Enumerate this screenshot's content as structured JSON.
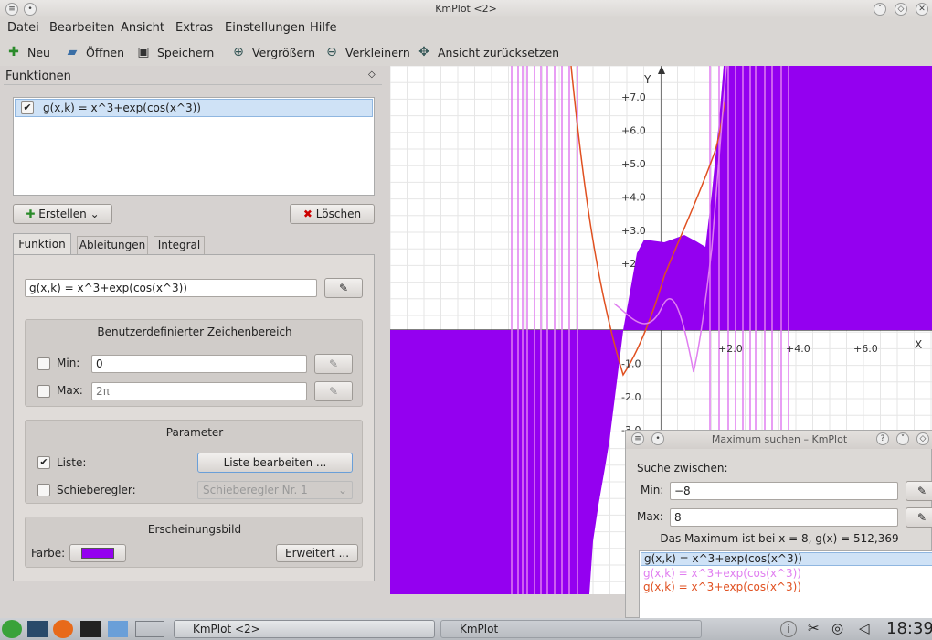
{
  "window": {
    "title": "KmPlot <2>"
  },
  "menu": [
    "Datei",
    "Bearbeiten",
    "Ansicht",
    "Extras",
    "Einstellungen",
    "Hilfe"
  ],
  "toolbar": {
    "new": "Neu",
    "open": "Öffnen",
    "save": "Speichern",
    "zoom_in": "Vergrößern",
    "zoom_out": "Verkleinern",
    "reset": "Ansicht zurücksetzen"
  },
  "functions_panel": {
    "title": "Funktionen",
    "list": [
      {
        "label": "g(x,k) = x^3+exp(cos(x^3))",
        "checked": true
      }
    ],
    "create_button": "Erstellen",
    "delete_button": "Löschen",
    "tabs": [
      "Funktion",
      "Ableitungen",
      "Integral"
    ],
    "equation": "g(x,k) = x^3+exp(cos(x^3))",
    "range": {
      "title": "Benutzerdefinierter Zeichenbereich",
      "min_label": "Min:",
      "min_value": "0",
      "max_label": "Max:",
      "max_value": "2π"
    },
    "parameter": {
      "title": "Parameter",
      "list_label": "Liste:",
      "list_button": "Liste bearbeiten ...",
      "slider_label": "Schieberegler:",
      "slider_value": "Schieberegler Nr. 1"
    },
    "appearance": {
      "title": "Erscheinungsbild",
      "color_label": "Farbe:",
      "color": "#9400f0",
      "advanced_button": "Erweitert ..."
    }
  },
  "plot": {
    "y_axis_label": "Y",
    "x_axis_label": "X",
    "y_ticks": [
      "+7.0",
      "+6.0",
      "+5.0",
      "+4.0",
      "+3.0",
      "+2",
      "-1.0",
      "-2.0",
      "-3.0"
    ],
    "x_ticks": [
      "+2.0",
      "+4.0",
      "+6.0"
    ],
    "colors": {
      "fill": "#9400f0",
      "pink": "#e07ef0",
      "orange": "#e05020"
    }
  },
  "dialog": {
    "title": "Maximum suchen – KmPlot",
    "search_label": "Suche zwischen:",
    "min_label": "Min:",
    "min_value": "−8",
    "max_label": "Max:",
    "max_value": "8",
    "result": "Das Maximum ist bei x = 8, g(x) = 512,369",
    "functions": [
      "g(x,k) = x^3+exp(cos(x^3))",
      "g(x,k) = x^3+exp(cos(x^3))",
      "g(x,k) = x^3+exp(cos(x^3))"
    ]
  },
  "taskbar": {
    "task1": "KmPlot <2>",
    "task2": "KmPlot",
    "clock": "18:39"
  }
}
